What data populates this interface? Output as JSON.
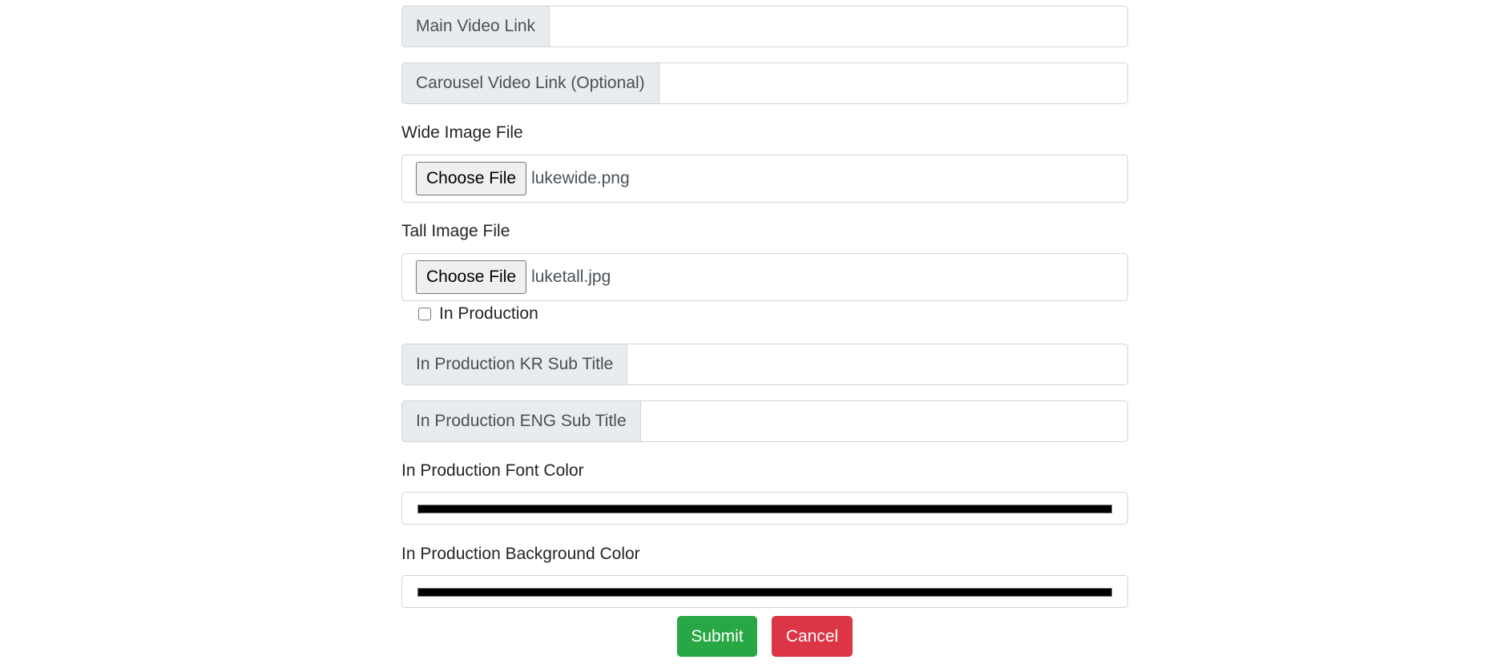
{
  "fields": {
    "main_video_link": {
      "label": "Main Video Link",
      "value": ""
    },
    "carousel_video_link": {
      "label": "Carousel Video Link (Optional)",
      "value": ""
    },
    "in_production_kr_sub_title": {
      "label": "In Production KR Sub Title",
      "value": ""
    },
    "in_production_eng_sub_title": {
      "label": "In Production ENG Sub Title",
      "value": ""
    }
  },
  "wide_image": {
    "label": "Wide Image File",
    "button_label": "Choose File",
    "file_name": "lukewide.png"
  },
  "tall_image": {
    "label": "Tall Image File",
    "button_label": "Choose File",
    "file_name": "luketall.jpg"
  },
  "in_production": {
    "label": "In Production",
    "checked": false
  },
  "font_color": {
    "label": "In Production Font Color",
    "value": "#000000"
  },
  "background_color": {
    "label": "In Production Background Color",
    "value": "#000000"
  },
  "actions": {
    "submit_label": "Submit",
    "cancel_label": "Cancel",
    "submit_color": "#28a745",
    "cancel_color": "#dc3545"
  }
}
